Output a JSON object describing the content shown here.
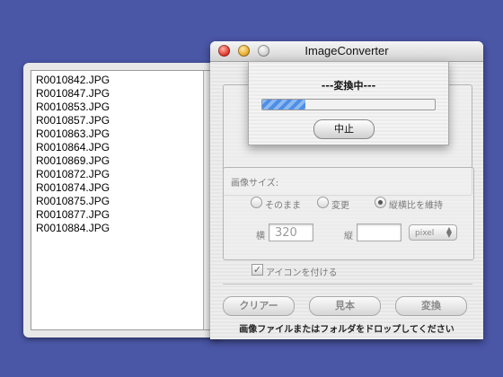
{
  "file_list": {
    "items": [
      "R0010842.JPG",
      "R0010847.JPG",
      "R0010853.JPG",
      "R0010857.JPG",
      "R0010863.JPG",
      "R0010864.JPG",
      "R0010869.JPG",
      "R0010872.JPG",
      "R0010874.JPG",
      "R0010875.JPG",
      "R0010877.JPG",
      "R0010884.JPG"
    ]
  },
  "window": {
    "title": "ImageConverter"
  },
  "sheet": {
    "message": "---変換中---",
    "progress": 0.25,
    "stop_label": "中止"
  },
  "image_size": {
    "heading": "画像サイズ:",
    "options": [
      "そのまま",
      "変更",
      "縦横比を維持"
    ],
    "selected": "縦横比を維持",
    "width_label": "横",
    "width_value": "320",
    "height_label": "縦",
    "height_value": "",
    "unit": "pixel"
  },
  "icon_option": {
    "label": "アイコンを付ける",
    "checked": true
  },
  "buttons": {
    "clear": "クリアー",
    "preview": "見本",
    "convert": "変換"
  },
  "status_text": "画像ファイルまたはフォルダをドロップしてください",
  "colors": {
    "desktop": "#4a56a6",
    "progress": "#4f8ee6"
  }
}
